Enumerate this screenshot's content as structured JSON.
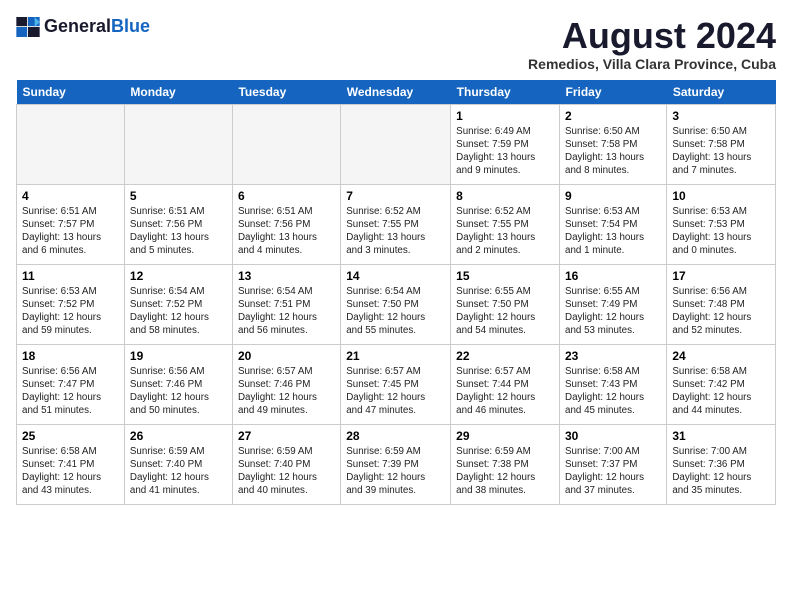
{
  "header": {
    "logo_general": "General",
    "logo_blue": "Blue",
    "month_year": "August 2024",
    "location": "Remedios, Villa Clara Province, Cuba"
  },
  "days_of_week": [
    "Sunday",
    "Monday",
    "Tuesday",
    "Wednesday",
    "Thursday",
    "Friday",
    "Saturday"
  ],
  "weeks": [
    [
      {
        "day": "",
        "info": ""
      },
      {
        "day": "",
        "info": ""
      },
      {
        "day": "",
        "info": ""
      },
      {
        "day": "",
        "info": ""
      },
      {
        "day": "1",
        "info": "Sunrise: 6:49 AM\nSunset: 7:59 PM\nDaylight: 13 hours\nand 9 minutes."
      },
      {
        "day": "2",
        "info": "Sunrise: 6:50 AM\nSunset: 7:58 PM\nDaylight: 13 hours\nand 8 minutes."
      },
      {
        "day": "3",
        "info": "Sunrise: 6:50 AM\nSunset: 7:58 PM\nDaylight: 13 hours\nand 7 minutes."
      }
    ],
    [
      {
        "day": "4",
        "info": "Sunrise: 6:51 AM\nSunset: 7:57 PM\nDaylight: 13 hours\nand 6 minutes."
      },
      {
        "day": "5",
        "info": "Sunrise: 6:51 AM\nSunset: 7:56 PM\nDaylight: 13 hours\nand 5 minutes."
      },
      {
        "day": "6",
        "info": "Sunrise: 6:51 AM\nSunset: 7:56 PM\nDaylight: 13 hours\nand 4 minutes."
      },
      {
        "day": "7",
        "info": "Sunrise: 6:52 AM\nSunset: 7:55 PM\nDaylight: 13 hours\nand 3 minutes."
      },
      {
        "day": "8",
        "info": "Sunrise: 6:52 AM\nSunset: 7:55 PM\nDaylight: 13 hours\nand 2 minutes."
      },
      {
        "day": "9",
        "info": "Sunrise: 6:53 AM\nSunset: 7:54 PM\nDaylight: 13 hours\nand 1 minute."
      },
      {
        "day": "10",
        "info": "Sunrise: 6:53 AM\nSunset: 7:53 PM\nDaylight: 13 hours\nand 0 minutes."
      }
    ],
    [
      {
        "day": "11",
        "info": "Sunrise: 6:53 AM\nSunset: 7:52 PM\nDaylight: 12 hours\nand 59 minutes."
      },
      {
        "day": "12",
        "info": "Sunrise: 6:54 AM\nSunset: 7:52 PM\nDaylight: 12 hours\nand 58 minutes."
      },
      {
        "day": "13",
        "info": "Sunrise: 6:54 AM\nSunset: 7:51 PM\nDaylight: 12 hours\nand 56 minutes."
      },
      {
        "day": "14",
        "info": "Sunrise: 6:54 AM\nSunset: 7:50 PM\nDaylight: 12 hours\nand 55 minutes."
      },
      {
        "day": "15",
        "info": "Sunrise: 6:55 AM\nSunset: 7:50 PM\nDaylight: 12 hours\nand 54 minutes."
      },
      {
        "day": "16",
        "info": "Sunrise: 6:55 AM\nSunset: 7:49 PM\nDaylight: 12 hours\nand 53 minutes."
      },
      {
        "day": "17",
        "info": "Sunrise: 6:56 AM\nSunset: 7:48 PM\nDaylight: 12 hours\nand 52 minutes."
      }
    ],
    [
      {
        "day": "18",
        "info": "Sunrise: 6:56 AM\nSunset: 7:47 PM\nDaylight: 12 hours\nand 51 minutes."
      },
      {
        "day": "19",
        "info": "Sunrise: 6:56 AM\nSunset: 7:46 PM\nDaylight: 12 hours\nand 50 minutes."
      },
      {
        "day": "20",
        "info": "Sunrise: 6:57 AM\nSunset: 7:46 PM\nDaylight: 12 hours\nand 49 minutes."
      },
      {
        "day": "21",
        "info": "Sunrise: 6:57 AM\nSunset: 7:45 PM\nDaylight: 12 hours\nand 47 minutes."
      },
      {
        "day": "22",
        "info": "Sunrise: 6:57 AM\nSunset: 7:44 PM\nDaylight: 12 hours\nand 46 minutes."
      },
      {
        "day": "23",
        "info": "Sunrise: 6:58 AM\nSunset: 7:43 PM\nDaylight: 12 hours\nand 45 minutes."
      },
      {
        "day": "24",
        "info": "Sunrise: 6:58 AM\nSunset: 7:42 PM\nDaylight: 12 hours\nand 44 minutes."
      }
    ],
    [
      {
        "day": "25",
        "info": "Sunrise: 6:58 AM\nSunset: 7:41 PM\nDaylight: 12 hours\nand 43 minutes."
      },
      {
        "day": "26",
        "info": "Sunrise: 6:59 AM\nSunset: 7:40 PM\nDaylight: 12 hours\nand 41 minutes."
      },
      {
        "day": "27",
        "info": "Sunrise: 6:59 AM\nSunset: 7:40 PM\nDaylight: 12 hours\nand 40 minutes."
      },
      {
        "day": "28",
        "info": "Sunrise: 6:59 AM\nSunset: 7:39 PM\nDaylight: 12 hours\nand 39 minutes."
      },
      {
        "day": "29",
        "info": "Sunrise: 6:59 AM\nSunset: 7:38 PM\nDaylight: 12 hours\nand 38 minutes."
      },
      {
        "day": "30",
        "info": "Sunrise: 7:00 AM\nSunset: 7:37 PM\nDaylight: 12 hours\nand 37 minutes."
      },
      {
        "day": "31",
        "info": "Sunrise: 7:00 AM\nSunset: 7:36 PM\nDaylight: 12 hours\nand 35 minutes."
      }
    ]
  ]
}
